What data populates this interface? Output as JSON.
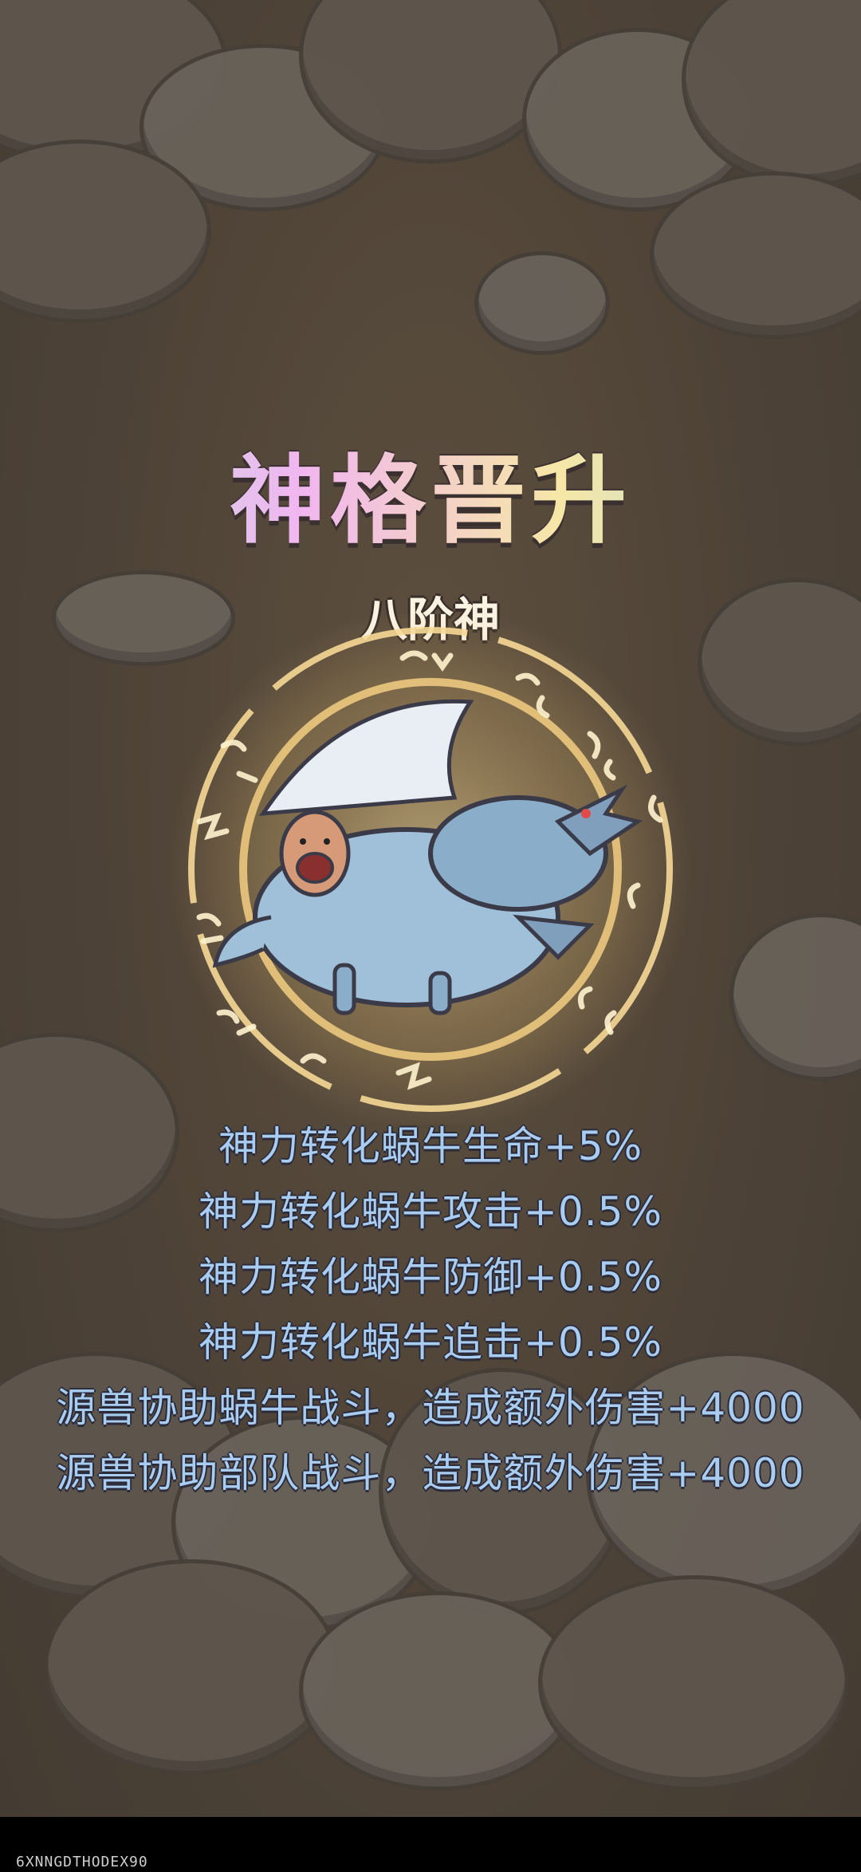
{
  "screen": {
    "title": "神格晋升",
    "rank": "八阶神",
    "stats": [
      "神力转化蜗牛生命+5%",
      "神力转化蜗牛攻击+0.5%",
      "神力转化蜗牛防御+0.5%",
      "神力转化蜗牛追击+0.5%",
      "源兽协助蜗牛战斗，造成额外伤害+4000",
      "源兽协助部队战斗，造成额外伤害+4000"
    ],
    "watermark": "6XNNGDTHODEX90"
  },
  "colors": {
    "background": "#5a4d3f",
    "stat_text": "#a9ccf1",
    "ring_glow": "#f6d896",
    "bottom_bar": "#000000"
  },
  "icons": {
    "emblem": "dragon-god-emblem",
    "clouds": "cloud-decoration"
  }
}
